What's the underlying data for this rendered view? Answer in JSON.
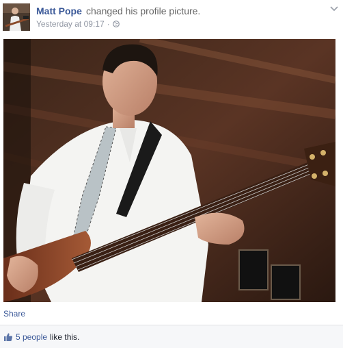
{
  "post": {
    "author": "Matt Pope",
    "action": "changed his profile picture.",
    "timestamp": "Yesterday at 09:17",
    "separator": "·",
    "privacy_icon": "globe-icon",
    "options_icon": "chevron-down-icon",
    "avatar_alt": "Profile picture of Matt Pope",
    "photo_alt": "Man in white shirt and tie playing a bass guitar"
  },
  "footer": {
    "share_label": "Share",
    "likes_link": "5 people",
    "likes_suffix": "like this.",
    "like_icon": "thumbs-up-icon"
  },
  "colors": {
    "link": "#3b5998",
    "meta": "#9197a3",
    "footer_bg": "#f6f7f9"
  }
}
